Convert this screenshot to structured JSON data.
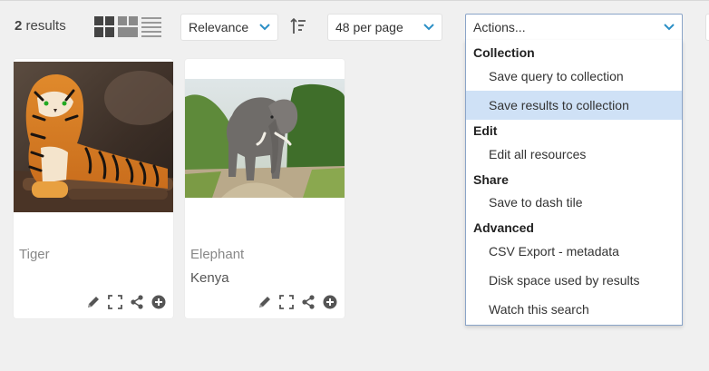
{
  "results": {
    "count": "2",
    "label": "results"
  },
  "sort": {
    "selected": "Relevance"
  },
  "per_page": {
    "selected": "48 per page"
  },
  "actions": {
    "selected": "Actions...",
    "groups": [
      {
        "label": "Collection",
        "items": [
          "Save query to collection",
          "Save results to collection"
        ]
      },
      {
        "label": "Edit",
        "items": [
          "Edit all resources"
        ]
      },
      {
        "label": "Share",
        "items": [
          "Save to dash tile"
        ]
      },
      {
        "label": "Advanced",
        "items": [
          "CSV Export - metadata",
          "Disk space used by results",
          "Watch this search"
        ]
      }
    ],
    "highlighted": "Save results to collection"
  },
  "cards": [
    {
      "title": "Tiger",
      "subtitle": ""
    },
    {
      "title": "Elephant",
      "subtitle": "Kenya"
    }
  ],
  "colors": {
    "accent": "#2b8fc6",
    "highlight": "#cfe1f6",
    "dropdown_border": "#8aa4c8",
    "background": "#f0f0f0"
  }
}
